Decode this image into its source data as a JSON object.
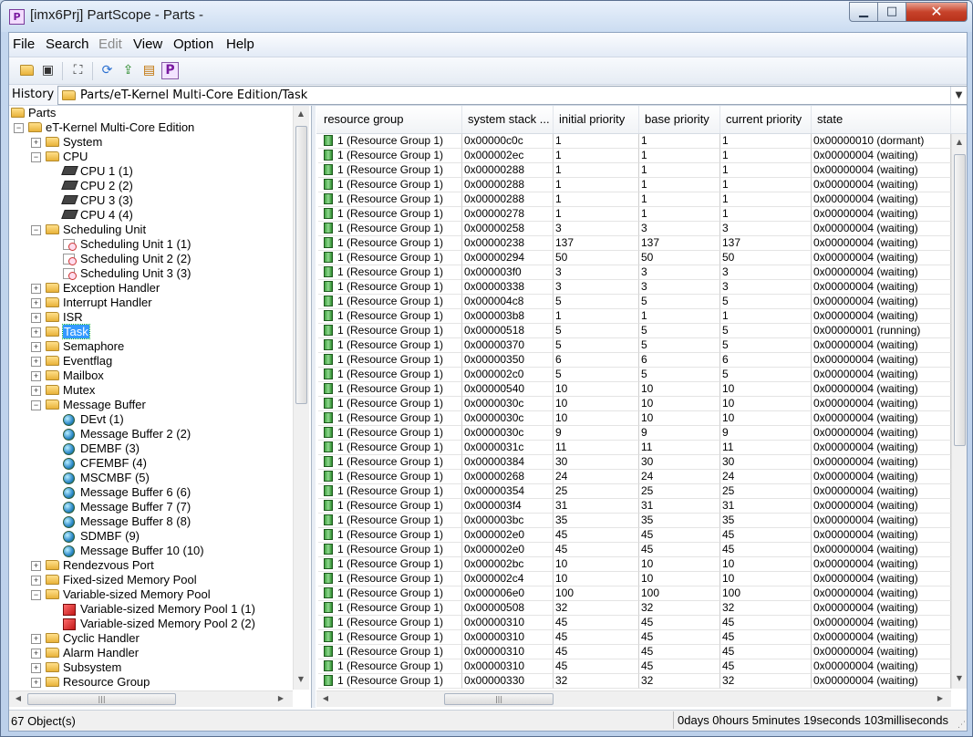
{
  "window": {
    "title": "[imx6Prj] PartScope - Parts -",
    "app_icon": "P",
    "minimize": "▁",
    "maximize": "□",
    "close": "✕"
  },
  "menu": [
    {
      "label": "File",
      "disabled": false
    },
    {
      "label": "Search",
      "disabled": false
    },
    {
      "label": "Edit",
      "disabled": true
    },
    {
      "label": "View",
      "disabled": false
    },
    {
      "label": "Option",
      "disabled": false
    },
    {
      "label": "Help",
      "disabled": false
    }
  ],
  "toolbar": {
    "buttons": [
      "open-folder-icon",
      "save-icon",
      "binoculars-icon",
      "refresh-icon",
      "export-icon",
      "properties-icon",
      "partscope-icon"
    ]
  },
  "history": {
    "label": "History",
    "path": "Parts/eT-Kernel Multi-Core Edition/Task"
  },
  "tree": [
    {
      "label": "Parts",
      "level": 0,
      "icon": "folder",
      "exp": ""
    },
    {
      "label": "eT-Kernel Multi-Core Edition",
      "level": 1,
      "icon": "folder",
      "exp": "−"
    },
    {
      "label": "System",
      "level": 2,
      "icon": "folder",
      "exp": "+"
    },
    {
      "label": "CPU",
      "level": 2,
      "icon": "folder",
      "exp": "−"
    },
    {
      "label": "CPU 1 (1)",
      "level": 3,
      "icon": "cpu",
      "exp": ""
    },
    {
      "label": "CPU 2 (2)",
      "level": 3,
      "icon": "cpu",
      "exp": ""
    },
    {
      "label": "CPU 3 (3)",
      "level": 3,
      "icon": "cpu",
      "exp": ""
    },
    {
      "label": "CPU 4 (4)",
      "level": 3,
      "icon": "cpu",
      "exp": ""
    },
    {
      "label": "Scheduling Unit",
      "level": 2,
      "icon": "folder",
      "exp": "−"
    },
    {
      "label": "Scheduling Unit 1 (1)",
      "level": 3,
      "icon": "sched",
      "exp": ""
    },
    {
      "label": "Scheduling Unit 2 (2)",
      "level": 3,
      "icon": "sched",
      "exp": ""
    },
    {
      "label": "Scheduling Unit 3 (3)",
      "level": 3,
      "icon": "sched",
      "exp": ""
    },
    {
      "label": "Exception Handler",
      "level": 2,
      "icon": "folder",
      "exp": "+"
    },
    {
      "label": "Interrupt Handler",
      "level": 2,
      "icon": "folder",
      "exp": "+"
    },
    {
      "label": "ISR",
      "level": 2,
      "icon": "folder",
      "exp": "+"
    },
    {
      "label": "Task",
      "level": 2,
      "icon": "folder",
      "exp": "+",
      "selected": true
    },
    {
      "label": "Semaphore",
      "level": 2,
      "icon": "folder",
      "exp": "+"
    },
    {
      "label": "Eventflag",
      "level": 2,
      "icon": "folder",
      "exp": "+"
    },
    {
      "label": "Mailbox",
      "level": 2,
      "icon": "folder",
      "exp": "+"
    },
    {
      "label": "Mutex",
      "level": 2,
      "icon": "folder",
      "exp": "+"
    },
    {
      "label": "Message Buffer",
      "level": 2,
      "icon": "folder",
      "exp": "−"
    },
    {
      "label": "DEvt (1)",
      "level": 3,
      "icon": "globe",
      "exp": ""
    },
    {
      "label": "Message Buffer 2 (2)",
      "level": 3,
      "icon": "globe",
      "exp": ""
    },
    {
      "label": "DEMBF (3)",
      "level": 3,
      "icon": "globe",
      "exp": ""
    },
    {
      "label": "CFEMBF (4)",
      "level": 3,
      "icon": "globe",
      "exp": ""
    },
    {
      "label": "MSCMBF (5)",
      "level": 3,
      "icon": "globe",
      "exp": ""
    },
    {
      "label": "Message Buffer 6 (6)",
      "level": 3,
      "icon": "globe",
      "exp": ""
    },
    {
      "label": "Message Buffer 7 (7)",
      "level": 3,
      "icon": "globe",
      "exp": ""
    },
    {
      "label": "Message Buffer 8 (8)",
      "level": 3,
      "icon": "globe",
      "exp": ""
    },
    {
      "label": "SDMBF (9)",
      "level": 3,
      "icon": "globe",
      "exp": ""
    },
    {
      "label": "Message Buffer 10 (10)",
      "level": 3,
      "icon": "globe",
      "exp": ""
    },
    {
      "label": "Rendezvous Port",
      "level": 2,
      "icon": "folder",
      "exp": "+"
    },
    {
      "label": "Fixed-sized Memory Pool",
      "level": 2,
      "icon": "folder",
      "exp": "+"
    },
    {
      "label": "Variable-sized Memory Pool",
      "level": 2,
      "icon": "folder",
      "exp": "−"
    },
    {
      "label": "Variable-sized Memory Pool 1 (1)",
      "level": 3,
      "icon": "pool",
      "exp": ""
    },
    {
      "label": "Variable-sized Memory Pool 2 (2)",
      "level": 3,
      "icon": "pool",
      "exp": ""
    },
    {
      "label": "Cyclic Handler",
      "level": 2,
      "icon": "folder",
      "exp": "+"
    },
    {
      "label": "Alarm Handler",
      "level": 2,
      "icon": "folder",
      "exp": "+"
    },
    {
      "label": "Subsystem",
      "level": 2,
      "icon": "folder",
      "exp": "+"
    },
    {
      "label": "Resource Group",
      "level": 2,
      "icon": "folder",
      "exp": "+"
    }
  ],
  "grid": {
    "columns": [
      "resource group",
      "system stack ...",
      "initial priority",
      "base priority",
      "current priority",
      "state"
    ],
    "rows": [
      [
        "1 (Resource Group 1)",
        "0x00000c0c",
        "1",
        "1",
        "1",
        "0x00000010 (dormant)"
      ],
      [
        "1 (Resource Group 1)",
        "0x000002ec",
        "1",
        "1",
        "1",
        "0x00000004 (waiting)"
      ],
      [
        "1 (Resource Group 1)",
        "0x00000288",
        "1",
        "1",
        "1",
        "0x00000004 (waiting)"
      ],
      [
        "1 (Resource Group 1)",
        "0x00000288",
        "1",
        "1",
        "1",
        "0x00000004 (waiting)"
      ],
      [
        "1 (Resource Group 1)",
        "0x00000288",
        "1",
        "1",
        "1",
        "0x00000004 (waiting)"
      ],
      [
        "1 (Resource Group 1)",
        "0x00000278",
        "1",
        "1",
        "1",
        "0x00000004 (waiting)"
      ],
      [
        "1 (Resource Group 1)",
        "0x00000258",
        "3",
        "3",
        "3",
        "0x00000004 (waiting)"
      ],
      [
        "1 (Resource Group 1)",
        "0x00000238",
        "137",
        "137",
        "137",
        "0x00000004 (waiting)"
      ],
      [
        "1 (Resource Group 1)",
        "0x00000294",
        "50",
        "50",
        "50",
        "0x00000004 (waiting)"
      ],
      [
        "1 (Resource Group 1)",
        "0x000003f0",
        "3",
        "3",
        "3",
        "0x00000004 (waiting)"
      ],
      [
        "1 (Resource Group 1)",
        "0x00000338",
        "3",
        "3",
        "3",
        "0x00000004 (waiting)"
      ],
      [
        "1 (Resource Group 1)",
        "0x000004c8",
        "5",
        "5",
        "5",
        "0x00000004 (waiting)"
      ],
      [
        "1 (Resource Group 1)",
        "0x000003b8",
        "1",
        "1",
        "1",
        "0x00000004 (waiting)"
      ],
      [
        "1 (Resource Group 1)",
        "0x00000518",
        "5",
        "5",
        "5",
        "0x00000001 (running)"
      ],
      [
        "1 (Resource Group 1)",
        "0x00000370",
        "5",
        "5",
        "5",
        "0x00000004 (waiting)"
      ],
      [
        "1 (Resource Group 1)",
        "0x00000350",
        "6",
        "6",
        "6",
        "0x00000004 (waiting)"
      ],
      [
        "1 (Resource Group 1)",
        "0x000002c0",
        "5",
        "5",
        "5",
        "0x00000004 (waiting)"
      ],
      [
        "1 (Resource Group 1)",
        "0x00000540",
        "10",
        "10",
        "10",
        "0x00000004 (waiting)"
      ],
      [
        "1 (Resource Group 1)",
        "0x0000030c",
        "10",
        "10",
        "10",
        "0x00000004 (waiting)"
      ],
      [
        "1 (Resource Group 1)",
        "0x0000030c",
        "10",
        "10",
        "10",
        "0x00000004 (waiting)"
      ],
      [
        "1 (Resource Group 1)",
        "0x0000030c",
        "9",
        "9",
        "9",
        "0x00000004 (waiting)"
      ],
      [
        "1 (Resource Group 1)",
        "0x0000031c",
        "11",
        "11",
        "11",
        "0x00000004 (waiting)"
      ],
      [
        "1 (Resource Group 1)",
        "0x00000384",
        "30",
        "30",
        "30",
        "0x00000004 (waiting)"
      ],
      [
        "1 (Resource Group 1)",
        "0x00000268",
        "24",
        "24",
        "24",
        "0x00000004 (waiting)"
      ],
      [
        "1 (Resource Group 1)",
        "0x00000354",
        "25",
        "25",
        "25",
        "0x00000004 (waiting)"
      ],
      [
        "1 (Resource Group 1)",
        "0x000003f4",
        "31",
        "31",
        "31",
        "0x00000004 (waiting)"
      ],
      [
        "1 (Resource Group 1)",
        "0x000003bc",
        "35",
        "35",
        "35",
        "0x00000004 (waiting)"
      ],
      [
        "1 (Resource Group 1)",
        "0x000002e0",
        "45",
        "45",
        "45",
        "0x00000004 (waiting)"
      ],
      [
        "1 (Resource Group 1)",
        "0x000002e0",
        "45",
        "45",
        "45",
        "0x00000004 (waiting)"
      ],
      [
        "1 (Resource Group 1)",
        "0x000002bc",
        "10",
        "10",
        "10",
        "0x00000004 (waiting)"
      ],
      [
        "1 (Resource Group 1)",
        "0x000002c4",
        "10",
        "10",
        "10",
        "0x00000004 (waiting)"
      ],
      [
        "1 (Resource Group 1)",
        "0x000006e0",
        "100",
        "100",
        "100",
        "0x00000004 (waiting)"
      ],
      [
        "1 (Resource Group 1)",
        "0x00000508",
        "32",
        "32",
        "32",
        "0x00000004 (waiting)"
      ],
      [
        "1 (Resource Group 1)",
        "0x00000310",
        "45",
        "45",
        "45",
        "0x00000004 (waiting)"
      ],
      [
        "1 (Resource Group 1)",
        "0x00000310",
        "45",
        "45",
        "45",
        "0x00000004 (waiting)"
      ],
      [
        "1 (Resource Group 1)",
        "0x00000310",
        "45",
        "45",
        "45",
        "0x00000004 (waiting)"
      ],
      [
        "1 (Resource Group 1)",
        "0x00000310",
        "45",
        "45",
        "45",
        "0x00000004 (waiting)"
      ],
      [
        "1 (Resource Group 1)",
        "0x00000330",
        "32",
        "32",
        "32",
        "0x00000004 (waiting)"
      ]
    ]
  },
  "status": {
    "objects": "67 Object(s)",
    "elapsed": "0days 0hours 5minutes 19seconds 103milliseconds"
  }
}
